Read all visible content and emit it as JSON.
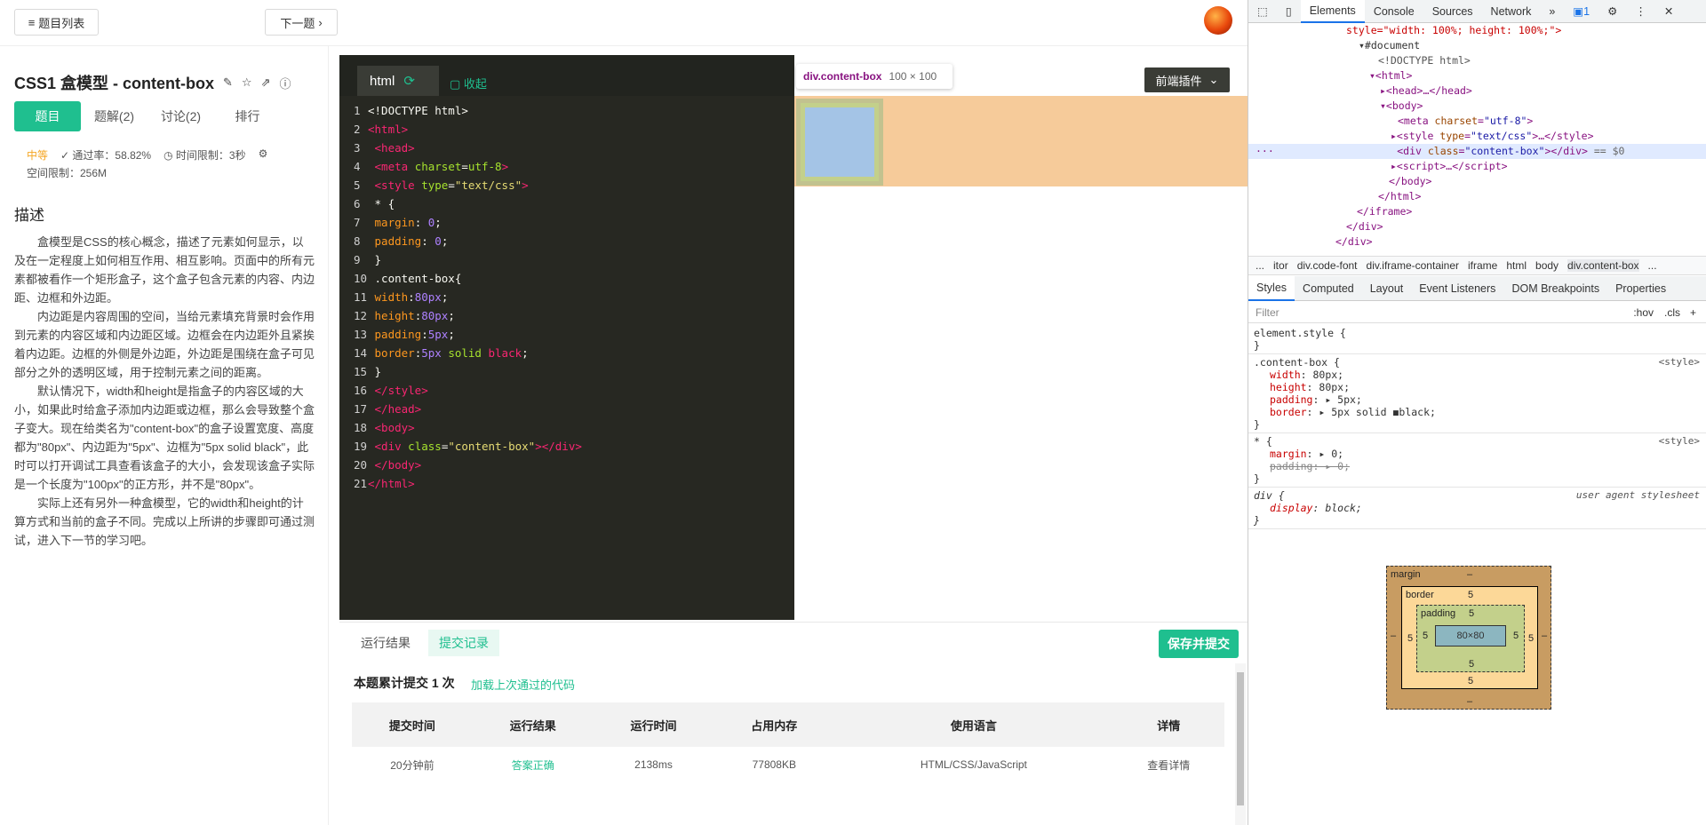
{
  "topbar": {
    "list_btn": "题目列表",
    "next_btn": "下一题"
  },
  "problem": {
    "title": "CSS1  盒模型 - content-box",
    "tabs": [
      "题目",
      "题解(2)",
      "讨论(2)",
      "排行"
    ],
    "difficulty": "中等",
    "pass_rate": "通过率：58.82%",
    "time_limit": "时间限制：3秒",
    "space_limit": "空间限制：256M",
    "desc_heading": "描述",
    "paragraphs": [
      "盒模型是CSS的核心概念，描述了元素如何显示，以及在一定程度上如何相互作用、相互影响。页面中的所有元素都被看作一个矩形盒子，这个盒子包含元素的内容、内边距、边框和外边距。",
      "内边距是内容周围的空间，当给元素填充背景时会作用到元素的内容区域和内边距区域。边框会在内边距外且紧挨着内边距。边框的外侧是外边距，外边距是围绕在盒子可见部分之外的透明区域，用于控制元素之间的距离。",
      "默认情况下，width和height是指盒子的内容区域的大小，如果此时给盒子添加内边距或边框，那么会导致整个盒子变大。现在给类名为\"content-box\"的盒子设置宽度、高度都为\"80px\"、内边距为\"5px\"、边框为\"5px solid black\"，此时可以打开调试工具查看该盒子的大小，会发现该盒子实际是一个长度为\"100px\"的正方形，并不是\"80px\"。",
      "实际上还有另外一种盒模型，它的width和height的计算方式和当前的盒子不同。完成以上所讲的步骤即可通过测试，进入下一节的学习吧。"
    ]
  },
  "editor": {
    "tab": "html",
    "collapse": "收起",
    "plugin": "前端插件"
  },
  "preview": {
    "tooltip_name": "div.content-box",
    "tooltip_size": "100 × 100"
  },
  "bottom": {
    "tabs": [
      "运行结果",
      "提交记录"
    ],
    "submit_btn": "保存并提交",
    "stat": "本题累计提交 1 次",
    "load_link": "加载上次通过的代码",
    "headers": [
      "提交时间",
      "运行结果",
      "运行时间",
      "占用内存",
      "使用语言",
      "详情"
    ],
    "row": [
      "20分钟前",
      "答案正确",
      "2138ms",
      "77808KB",
      "HTML/CSS/JavaScript",
      "查看详情"
    ]
  },
  "devtools": {
    "tabs": [
      "Elements",
      "Console",
      "Sources",
      "Network"
    ],
    "issues": "1",
    "crumbs": [
      "...",
      "itor",
      "div.code-font",
      "div.iframe-container",
      "iframe",
      "html",
      "body",
      "div.content-box",
      "..."
    ],
    "style_tabs": [
      "Styles",
      "Computed",
      "Layout",
      "Event Listeners",
      "DOM Breakpoints",
      "Properties"
    ],
    "filter": "Filter",
    "hov": ":hov",
    "cls": ".cls",
    "box": {
      "margin": "margin",
      "border": "border",
      "padding": "padding",
      "content": "80×80",
      "dash": "–",
      "five": "5"
    }
  },
  "colors": {
    "accent": "#1fbf8f"
  }
}
